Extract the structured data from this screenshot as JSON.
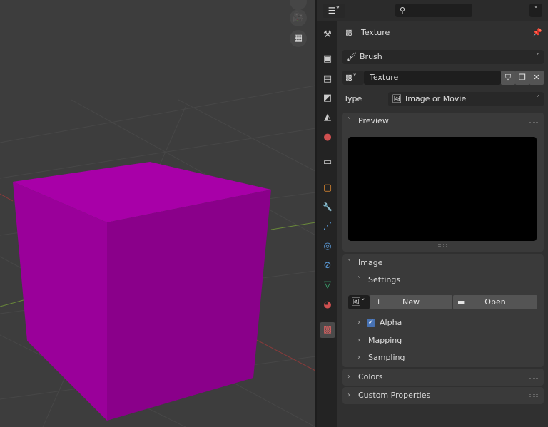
{
  "header": {
    "editor_icon": "properties-editor-icon",
    "search_icon": "search-icon"
  },
  "tabs": [
    {
      "name": "tool",
      "icon": "tool-icon",
      "glyph": "⚒"
    },
    {
      "name": "render",
      "icon": "render-icon",
      "glyph": "▣"
    },
    {
      "name": "output",
      "icon": "output-icon",
      "glyph": "▤"
    },
    {
      "name": "view-layer",
      "icon": "view-layer-icon",
      "glyph": "◩"
    },
    {
      "name": "scene",
      "icon": "scene-icon",
      "glyph": "◭"
    },
    {
      "name": "world",
      "icon": "world-icon",
      "glyph": "●"
    },
    {
      "name": "collection",
      "icon": "collection-icon",
      "glyph": "▭"
    },
    {
      "name": "object",
      "icon": "object-icon",
      "glyph": "▢"
    },
    {
      "name": "modifiers",
      "icon": "wrench-icon",
      "glyph": "🔧"
    },
    {
      "name": "particles",
      "icon": "particles-icon",
      "glyph": "⋰"
    },
    {
      "name": "physics",
      "icon": "physics-icon",
      "glyph": "◎"
    },
    {
      "name": "constraints",
      "icon": "constraints-icon",
      "glyph": "⊘"
    },
    {
      "name": "data",
      "icon": "mesh-data-icon",
      "glyph": "▽"
    },
    {
      "name": "material",
      "icon": "material-icon",
      "glyph": "◕"
    },
    {
      "name": "texture",
      "icon": "texture-icon",
      "glyph": "▩"
    }
  ],
  "context": {
    "title": "Texture",
    "brush": "Brush",
    "texture_name": "Texture",
    "type_label": "Type",
    "type_value": "Image or Movie"
  },
  "sections": {
    "preview": "Preview",
    "image": "Image",
    "settings": "Settings",
    "new": "New",
    "open": "Open",
    "alpha": "Alpha",
    "alpha_checked": true,
    "mapping": "Mapping",
    "sampling": "Sampling",
    "colors": "Colors",
    "custom_properties": "Custom Properties"
  },
  "colors": {
    "cube": "#a000a0",
    "accent": "#4772b3"
  }
}
